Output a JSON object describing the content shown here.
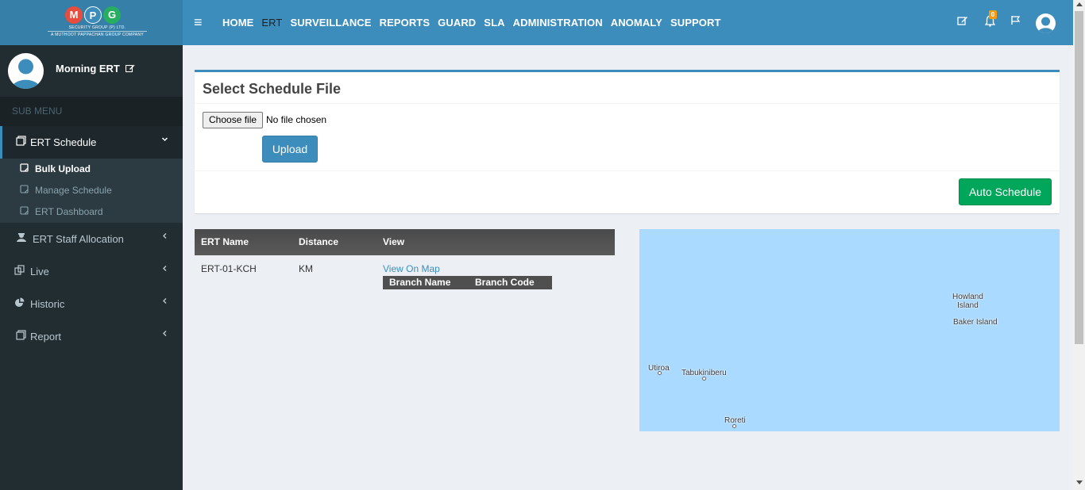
{
  "brand": {
    "letters": [
      "M",
      "P",
      "G"
    ],
    "letter_colors": [
      "#e74c3c",
      "#3c8dbc",
      "#27ae60"
    ],
    "subtitle": "SECURITY GROUP (P) LTD.",
    "tagline": "A MUTHOOT PAPPACHAN GROUP COMPANY"
  },
  "topnav": {
    "items": [
      "HOME",
      "ERT",
      "SURVEILLANCE",
      "REPORTS",
      "GUARD",
      "SLA",
      "ADMINISTRATION",
      "ANOMALY",
      "SUPPORT"
    ],
    "active": "ERT",
    "notification_count": "0"
  },
  "user_panel": {
    "name": "Morning ERT"
  },
  "sidebar": {
    "header": "SUB MENU",
    "items": [
      {
        "label": "ERT Schedule",
        "icon": "copy-icon",
        "expanded": true
      },
      {
        "label": "ERT Staff Allocation",
        "icon": "staff-icon"
      },
      {
        "label": "Live",
        "icon": "live-icon"
      },
      {
        "label": "Historic",
        "icon": "pie-chart-icon"
      },
      {
        "label": "Report",
        "icon": "copy-icon"
      }
    ],
    "subitems": [
      "Bulk Upload",
      "Manage Schedule",
      "ERT Dashboard"
    ],
    "current_subitem": "Bulk Upload"
  },
  "upload_box": {
    "title": "Select Schedule File",
    "choose_label": "Choose file",
    "file_status": "No file chosen",
    "upload_label": "Upload",
    "auto_schedule_label": "Auto Schedule"
  },
  "table": {
    "headers": [
      "ERT Name",
      "Distance",
      "View"
    ],
    "rows": [
      {
        "ert_name": "ERT-01-KCH",
        "distance": "KM",
        "view_link": "View On Map"
      }
    ],
    "sub_headers": [
      "Branch Name",
      "Branch Code"
    ]
  },
  "map": {
    "labels": [
      "Howland Island",
      "Baker Island",
      "Utiroa",
      "Tabukiniberu",
      "Roreti"
    ],
    "water_color": "#aadaff"
  },
  "colors": {
    "header": "#3c8dbc",
    "logo_bg": "#367fa9",
    "sidebar": "#222d32",
    "success": "#00a65a",
    "primary": "#3c8dbc"
  }
}
